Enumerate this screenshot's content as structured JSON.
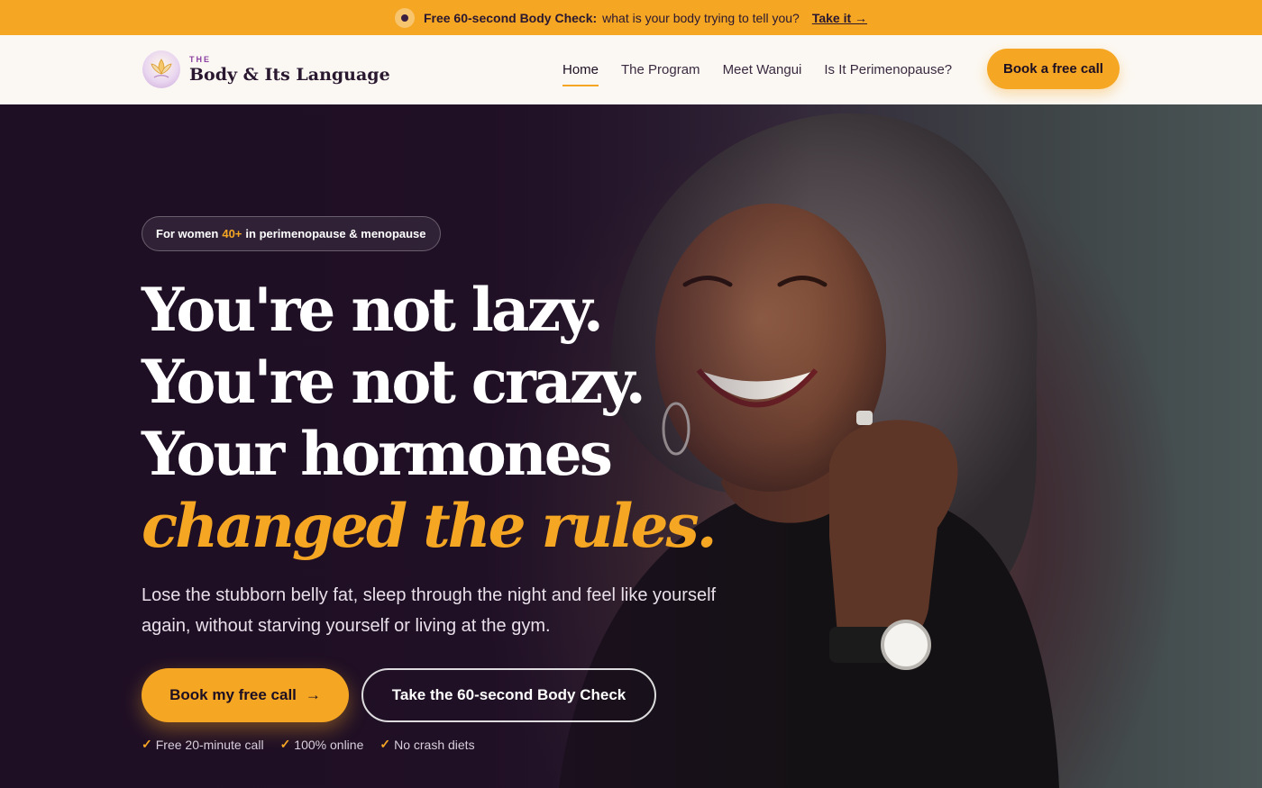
{
  "announcement": {
    "bold": "Free 60-second Body Check:",
    "text": "what is your body trying to tell you?",
    "link": "Take it →"
  },
  "brand": {
    "prefix": "THE",
    "name": "Body & Its Language",
    "accent_color": "#f5a623",
    "dark_color": "#1d0f22"
  },
  "nav": {
    "items": [
      {
        "label": "Home",
        "active": true
      },
      {
        "label": "The Program",
        "active": false
      },
      {
        "label": "Meet Wangui",
        "active": false
      },
      {
        "label": "Is It Perimenopause?",
        "active": false
      }
    ],
    "cta": "Book a free call"
  },
  "hero": {
    "badge_pre": "For women",
    "badge_highlight": "40+",
    "badge_post": "in perimenopause & menopause",
    "headline": [
      "You're not lazy.",
      "You're not crazy.",
      "Your hormones"
    ],
    "headline_accent": "changed the rules.",
    "subheadline": "Lose the stubborn belly fat, sleep through the night and feel like yourself again, without starving yourself or living at the gym.",
    "primary_cta": "Book my free call",
    "primary_cta_icon": "→",
    "secondary_cta": "Take the 60-second Body Check",
    "perks": [
      "Free 20-minute call",
      "100% online",
      "No crash diets"
    ],
    "check_icon": "✓"
  }
}
